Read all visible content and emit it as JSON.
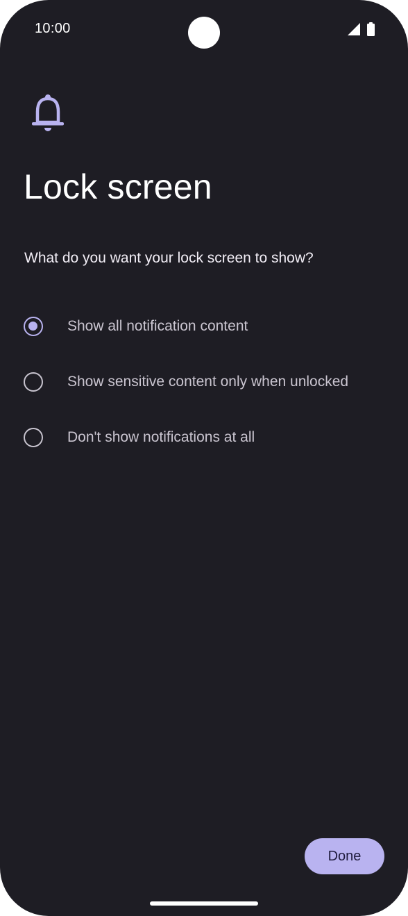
{
  "status_bar": {
    "time": "10:00",
    "icons": [
      "cellular-signal-icon",
      "battery-icon"
    ]
  },
  "header": {
    "icon": "bell-icon",
    "title": "Lock screen",
    "subtitle": "What do you want your lock screen to show?"
  },
  "options": [
    {
      "label": "Show all notification content",
      "selected": true
    },
    {
      "label": "Show sensitive content only when unlocked",
      "selected": false
    },
    {
      "label": "Don't show notifications at all",
      "selected": false
    }
  ],
  "footer": {
    "done_label": "Done"
  },
  "colors": {
    "background": "#1e1d24",
    "accent": "#b9b3f0",
    "text_primary": "#ffffff",
    "text_secondary": "#cac5d0"
  }
}
